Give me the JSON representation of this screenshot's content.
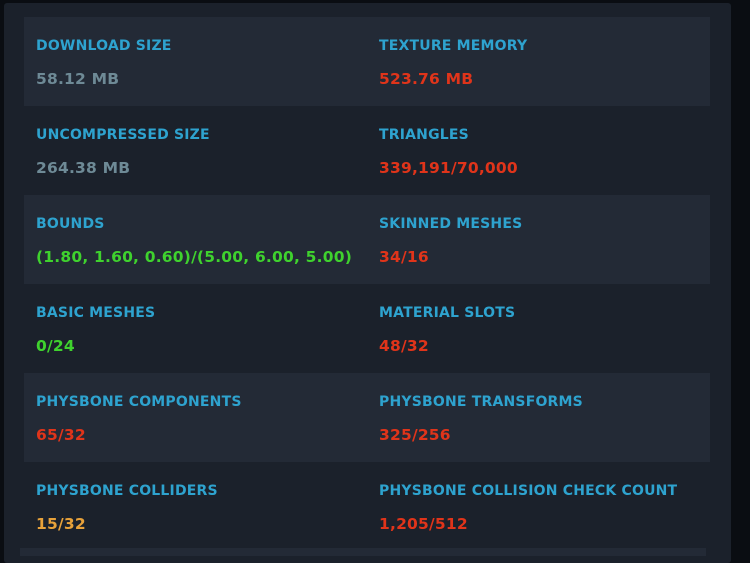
{
  "colors": {
    "label": "#2ea3cf",
    "neutral": "#6e8a96",
    "bad": "#e0341a",
    "good": "#3fd22e",
    "warning": "#e8a23a"
  },
  "stats": {
    "download_size": {
      "label": "DOWNLOAD SIZE",
      "value": "58.12 MB",
      "status": "neutral"
    },
    "texture_memory": {
      "label": "TEXTURE MEMORY",
      "value": "523.76 MB",
      "status": "bad"
    },
    "uncompressed_size": {
      "label": "UNCOMPRESSED SIZE",
      "value": "264.38 MB",
      "status": "neutral"
    },
    "triangles": {
      "label": "TRIANGLES",
      "value": "339,191/70,000",
      "status": "bad"
    },
    "bounds": {
      "label": "BOUNDS",
      "value": "(1.80, 1.60, 0.60)/(5.00, 6.00, 5.00)",
      "status": "good"
    },
    "skinned_meshes": {
      "label": "SKINNED MESHES",
      "value": "34/16",
      "status": "bad"
    },
    "basic_meshes": {
      "label": "BASIC MESHES",
      "value": "0/24",
      "status": "good"
    },
    "material_slots": {
      "label": "MATERIAL SLOTS",
      "value": "48/32",
      "status": "bad"
    },
    "physbone_components": {
      "label": "PHYSBONE COMPONENTS",
      "value": "65/32",
      "status": "bad"
    },
    "physbone_transforms": {
      "label": "PHYSBONE TRANSFORMS",
      "value": "325/256",
      "status": "bad"
    },
    "physbone_colliders": {
      "label": "PHYSBONE COLLIDERS",
      "value": "15/32",
      "status": "warning"
    },
    "physbone_collision_check_count": {
      "label": "PHYSBONE COLLISION CHECK COUNT",
      "value": "1,205/512",
      "status": "bad"
    }
  }
}
